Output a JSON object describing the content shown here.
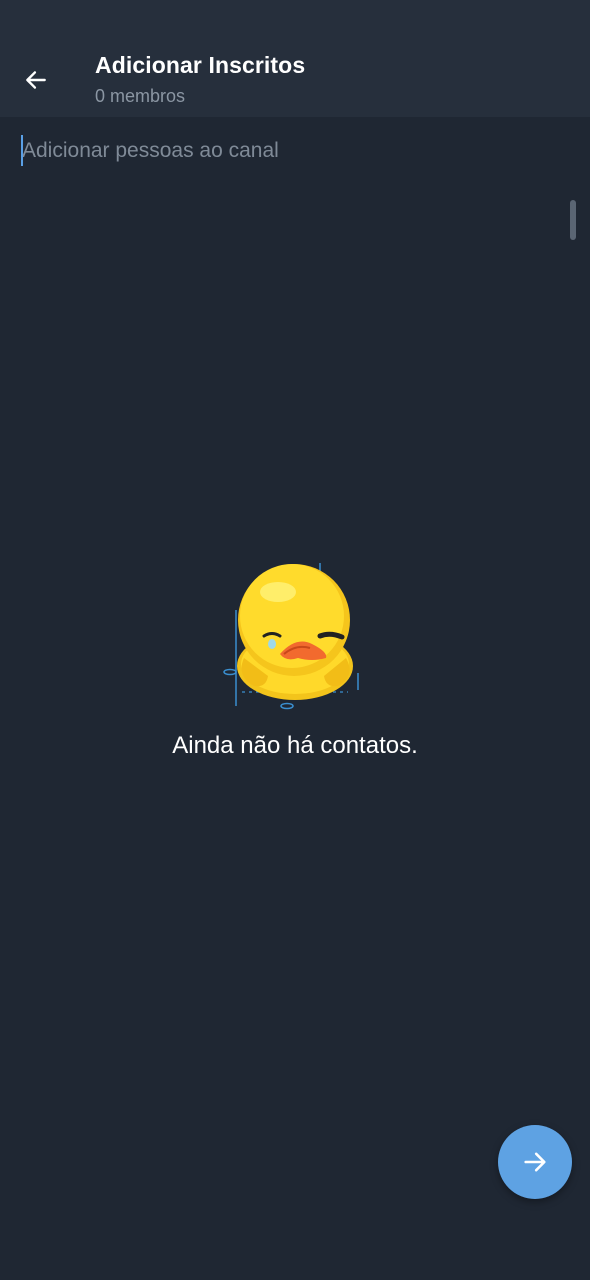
{
  "header": {
    "title": "Adicionar Inscritos",
    "subtitle": "0 membros",
    "back_icon": "arrow-left-icon"
  },
  "search": {
    "placeholder": "Adicionar pessoas ao canal",
    "value": ""
  },
  "empty_state": {
    "illustration": "sad-duck-sticker",
    "message": "Ainda não há contatos."
  },
  "fab": {
    "icon": "arrow-right-icon"
  },
  "colors": {
    "background": "#1f2733",
    "header_background": "#262f3c",
    "accent": "#5ea2e3",
    "secondary_text": "#8b96a3"
  }
}
